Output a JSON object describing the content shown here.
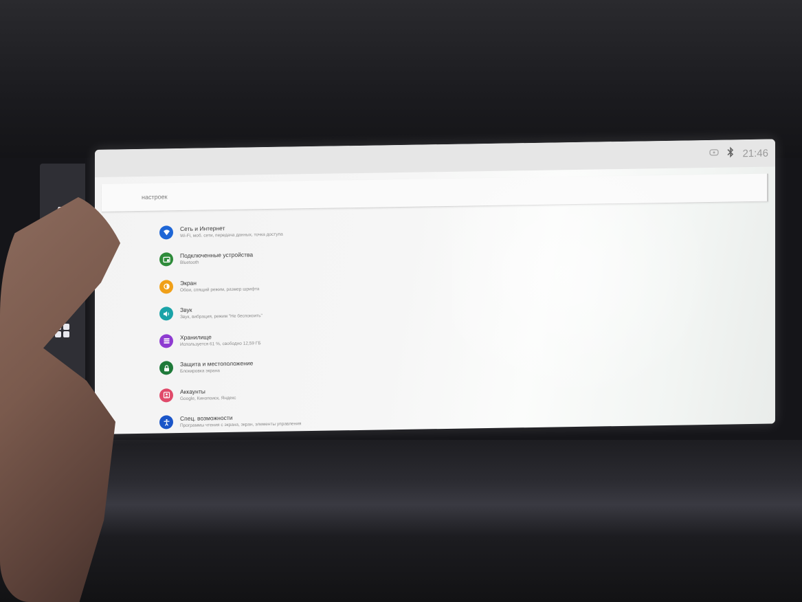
{
  "status": {
    "time": "21:46",
    "icons": [
      "wifi-off-icon",
      "bluetooth-icon"
    ]
  },
  "side_nav": {
    "icons": [
      "car-icon",
      "apps-grid-icon"
    ]
  },
  "search": {
    "placeholder": "настроек"
  },
  "settings": [
    {
      "title": "Сеть и Интернет",
      "subtitle": "Wi-Fi, моб. сети, передача данных, точка доступа",
      "color": "#1e66d6",
      "icon": "wifi-icon"
    },
    {
      "title": "Подключенные устройства",
      "subtitle": "Bluetooth",
      "color": "#2e8b3a",
      "icon": "devices-icon"
    },
    {
      "title": "Экран",
      "subtitle": "Обои, спящий режим, размер шрифта",
      "color": "#f0a019",
      "icon": "brightness-icon"
    },
    {
      "title": "Звук",
      "subtitle": "Звук, вибрация, режим \"Не беспокоить\"",
      "color": "#1aa3a8",
      "icon": "volume-icon"
    },
    {
      "title": "Хранилище",
      "subtitle": "Используется 61 %, свободно 12,59 ГБ",
      "color": "#8e3bd1",
      "icon": "storage-icon"
    },
    {
      "title": "Защита и местоположение",
      "subtitle": "Блокировка экрана",
      "color": "#1f7a3a",
      "icon": "lock-icon"
    },
    {
      "title": "Аккаунты",
      "subtitle": "Google, Кинопоиск, Яндекс",
      "color": "#e04a6a",
      "icon": "account-icon"
    },
    {
      "title": "Спец. возможности",
      "subtitle": "Программы чтения с экрана, экран, элементы управления",
      "color": "#1a55c8",
      "icon": "accessibility-icon"
    }
  ]
}
